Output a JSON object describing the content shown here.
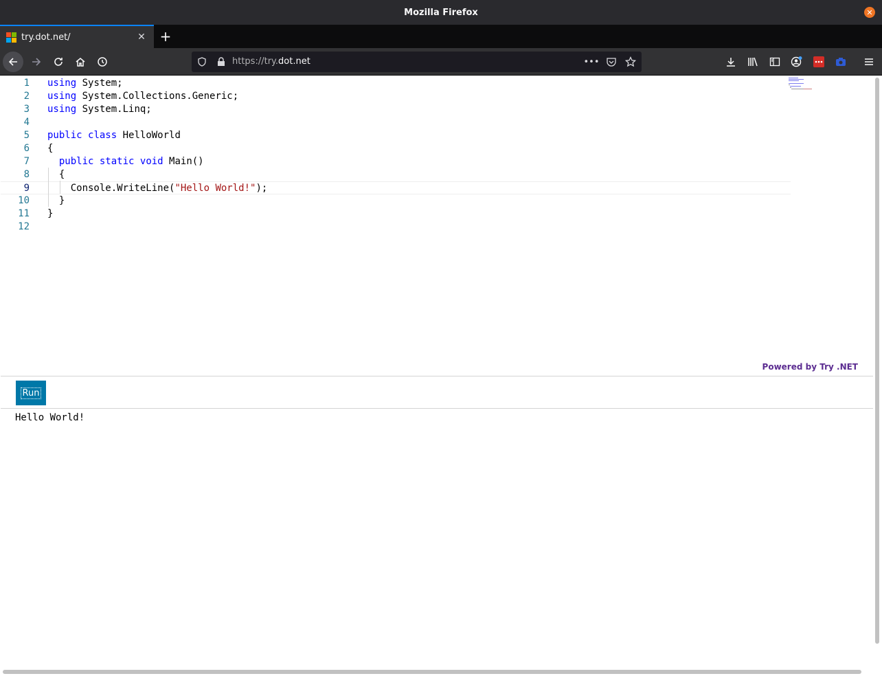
{
  "window": {
    "title": "Mozilla Firefox"
  },
  "tab": {
    "title": "try.dot.net/"
  },
  "url": {
    "scheme": "https://try.",
    "host": "dot.net"
  },
  "editor": {
    "lines": [
      {
        "n": "1",
        "tokens": [
          {
            "t": "using",
            "c": "kw"
          },
          {
            "t": " System;",
            "c": ""
          }
        ]
      },
      {
        "n": "2",
        "tokens": [
          {
            "t": "using",
            "c": "kw"
          },
          {
            "t": " System.Collections.Generic;",
            "c": ""
          }
        ]
      },
      {
        "n": "3",
        "tokens": [
          {
            "t": "using",
            "c": "kw"
          },
          {
            "t": " System.Linq;",
            "c": ""
          }
        ]
      },
      {
        "n": "4",
        "tokens": []
      },
      {
        "n": "5",
        "tokens": [
          {
            "t": "public",
            "c": "kw"
          },
          {
            "t": " ",
            "c": ""
          },
          {
            "t": "class",
            "c": "kw"
          },
          {
            "t": " HelloWorld",
            "c": ""
          }
        ]
      },
      {
        "n": "6",
        "tokens": [
          {
            "t": "{",
            "c": ""
          }
        ]
      },
      {
        "n": "7",
        "tokens": [
          {
            "t": "  ",
            "c": ""
          },
          {
            "t": "public",
            "c": "kw"
          },
          {
            "t": " ",
            "c": ""
          },
          {
            "t": "static",
            "c": "kw"
          },
          {
            "t": " ",
            "c": ""
          },
          {
            "t": "void",
            "c": "kw"
          },
          {
            "t": " Main()",
            "c": ""
          }
        ]
      },
      {
        "n": "8",
        "tokens": [
          {
            "t": "  {",
            "c": ""
          }
        ]
      },
      {
        "n": "9",
        "tokens": [
          {
            "t": "    Console.WriteLine(",
            "c": ""
          },
          {
            "t": "\"Hello World!\"",
            "c": "str"
          },
          {
            "t": ");",
            "c": ""
          }
        ]
      },
      {
        "n": "10",
        "tokens": [
          {
            "t": "  }",
            "c": ""
          }
        ]
      },
      {
        "n": "11",
        "tokens": [
          {
            "t": "}",
            "c": ""
          }
        ]
      },
      {
        "n": "12",
        "tokens": []
      }
    ],
    "current_line": 9
  },
  "powered_by": "Powered by Try .NET",
  "run_button": {
    "label": "Run"
  },
  "output": {
    "text": "Hello World!"
  }
}
